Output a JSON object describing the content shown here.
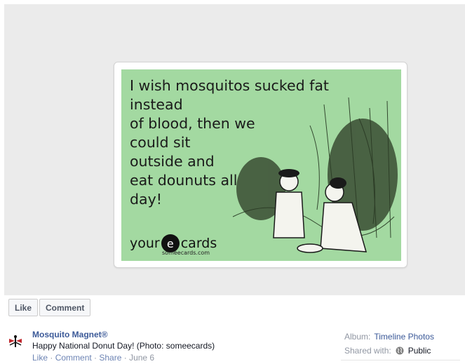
{
  "ecard": {
    "text": "I wish mosquitos sucked fat instead\nof blood, then we\ncould sit\noutside and\neat dounuts all\nday!",
    "logo_your": "your",
    "logo_e": "e",
    "logo_cards": "cards",
    "logo_site": "someecards.com",
    "background_color": "#a3d9a1"
  },
  "actions": {
    "like_label": "Like",
    "comment_label": "Comment"
  },
  "post": {
    "page_name": "Mosquito Magnet®",
    "caption": "Happy National Donut Day! (Photo: someecards)",
    "links": {
      "like": "Like",
      "comment": "Comment",
      "share": "Share",
      "date": "June 6",
      "separator": " · "
    }
  },
  "sidebar": {
    "album_label": "Album:",
    "album_value": "Timeline Photos",
    "shared_label": "Shared with:",
    "shared_value": "Public"
  },
  "icons": {
    "avatar": "mosquito-magnet-logo",
    "audience": "globe-icon"
  }
}
